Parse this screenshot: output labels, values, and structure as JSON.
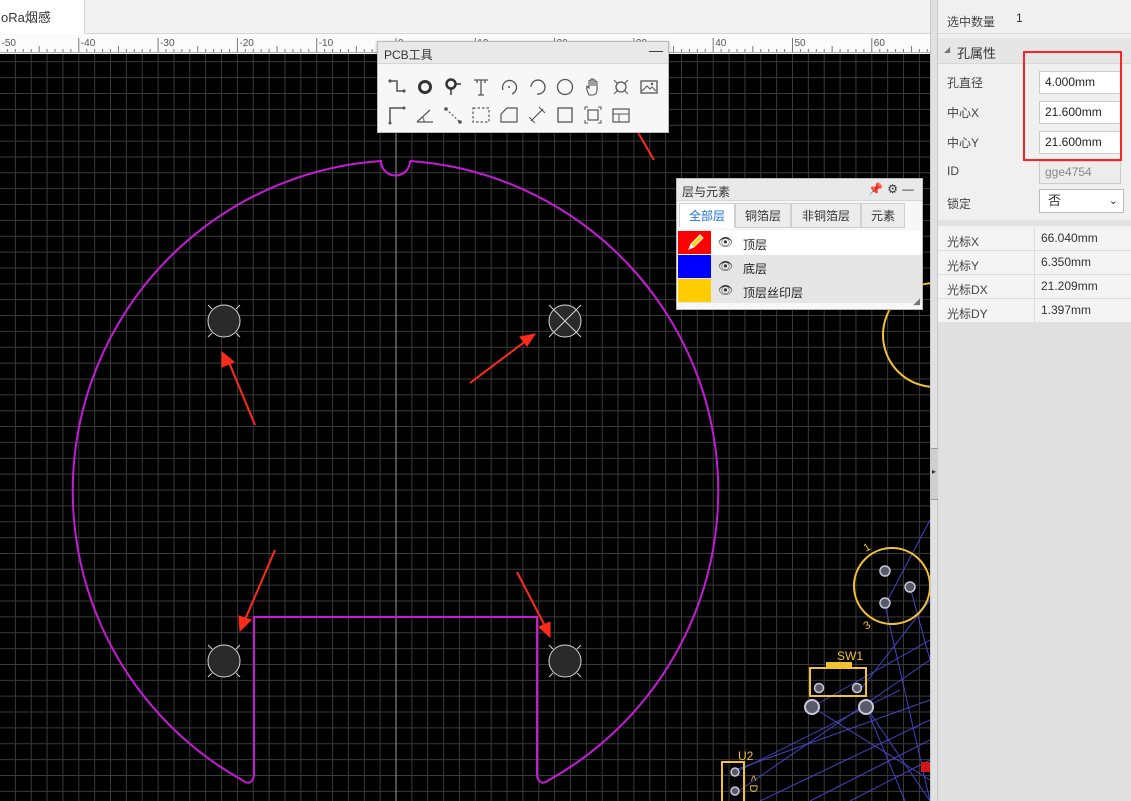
{
  "document_tab": "oRa烟感",
  "ruler_labels": [
    "-50",
    "-40",
    "-30",
    "-20",
    "-10",
    "0",
    "10",
    "20",
    "30",
    "40",
    "50",
    "60"
  ],
  "pcb_tools": {
    "title": "PCB工具",
    "minimize": "—",
    "tools_row1": [
      "track-icon",
      "pad-icon",
      "via-icon",
      "text-icon",
      "arc-icon",
      "center-arc-icon",
      "circle-icon",
      "pan-hand-icon",
      "hole-icon",
      "image-icon"
    ],
    "tools_row2": [
      "board-outline-icon",
      "angle-dimension-icon",
      "connect-icon",
      "copper-area-icon",
      "solid-region-icon",
      "dimension-icon",
      "rectangle-icon",
      "group-icon",
      "table-icon"
    ]
  },
  "layers_panel": {
    "title": "层与元素",
    "tabs": [
      "全部层",
      "铜箔层",
      "非铜箔层",
      "元素"
    ],
    "active_tab": 0,
    "layers": [
      {
        "name": "顶层",
        "color": "#ff0000",
        "active": true
      },
      {
        "name": "底层",
        "color": "#0000ff",
        "active": false
      },
      {
        "name": "顶层丝印层",
        "color": "#ffcc00",
        "active": false
      }
    ]
  },
  "properties": {
    "selected_count_label": "选中数量",
    "selected_count": "1",
    "section_title": "孔属性",
    "hole_diameter_label": "孔直径",
    "hole_diameter": "4.000mm",
    "center_x_label": "中心X",
    "center_x": "21.600mm",
    "center_y_label": "中心Y",
    "center_y": "21.600mm",
    "id_label": "ID",
    "id_value": "gge4754",
    "lock_label": "锁定",
    "lock_value": "否"
  },
  "cursor": [
    {
      "label": "光标X",
      "value": "66.040mm"
    },
    {
      "label": "光标Y",
      "value": "6.350mm"
    },
    {
      "label": "光标DX",
      "value": "21.209mm"
    },
    {
      "label": "光标DY",
      "value": "1.397mm"
    }
  ],
  "canvas_labels": {
    "sw1": "SW1",
    "u2": "U2",
    "pin1": "1",
    "pin3": "3",
    "u2_side": "< D"
  },
  "colors": {
    "canvas_bg": "#000000",
    "grid": "#3a3a3a",
    "board_outline": "#c51bd6",
    "silkscreen": "#f2c230",
    "ratsnest": "#4b4bd8",
    "annotation": "#ff2a1a",
    "accent": "#1e6fd0"
  }
}
